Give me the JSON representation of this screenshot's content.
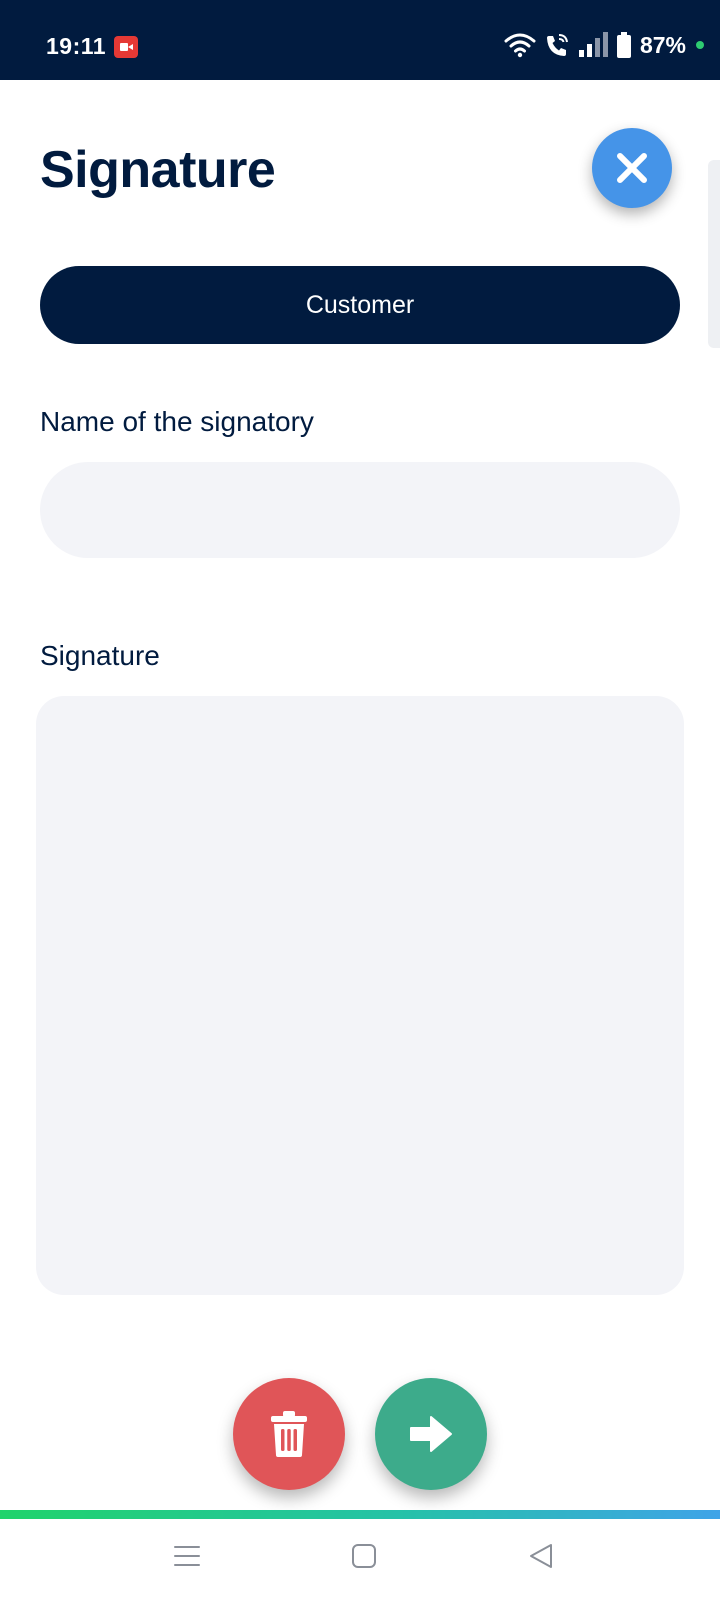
{
  "status_bar": {
    "time": "19:11",
    "battery": "87%",
    "icons": [
      "screen-record-icon",
      "wifi-icon",
      "wifi-call-icon",
      "signal-icon",
      "battery-icon"
    ]
  },
  "page": {
    "title": "Signature"
  },
  "tabs": {
    "active_label": "Customer"
  },
  "form": {
    "name_label": "Name of the signatory",
    "name_value": "",
    "name_placeholder": "",
    "signature_label": "Signature"
  },
  "actions": {
    "close_icon": "close-icon",
    "delete_icon": "trash-icon",
    "next_icon": "arrow-right-icon"
  },
  "colors": {
    "navy": "#011b3f",
    "close_blue": "#4594e8",
    "delete_red": "#e05558",
    "next_green": "#3dab8b",
    "field_bg": "#f3f4f8"
  }
}
